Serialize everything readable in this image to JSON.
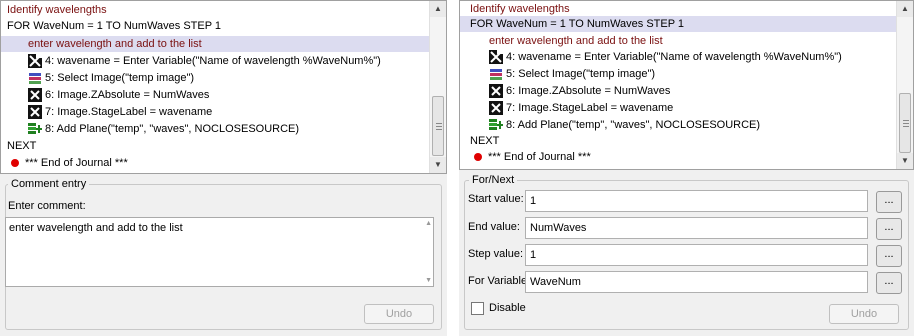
{
  "journal_lines": {
    "header": "Identify wavelengths",
    "for_line": "FOR WaveNum = 1 TO NumWaves STEP 1",
    "comment": "enter wavelength and add to the list",
    "step4": "4: wavename = Enter Variable(\"Name of wavelength %WaveNum%\")",
    "step5": "5: Select Image(\"temp image\")",
    "step6": "6: Image.ZAbsolute = NumWaves",
    "step7": "7: Image.StageLabel = wavename",
    "step8": "8: Add Plane(\"temp\", \"waves\", NOCLOSESOURCE)",
    "next": "NEXT",
    "end": "*** End of Journal ***"
  },
  "icons": {
    "step4": "enter-variable-icon",
    "step5": "select-image-icon",
    "step6": "variable-assign-icon",
    "step7": "variable-assign-icon",
    "step8": "add-plane-icon",
    "end": "end-marker-dot"
  },
  "left": {
    "group_title": "Comment entry",
    "enter_comment_label": "Enter comment:",
    "comment_value": "enter wavelength and add to the list",
    "undo_label": "Undo"
  },
  "right": {
    "group_title": "For/Next",
    "start_label": "Start value:",
    "start_value": "1",
    "end_label": "End value:",
    "end_value": "NumWaves",
    "step_label": "Step value:",
    "step_value": "1",
    "var_label": "For Variable:",
    "var_value": "WaveNum",
    "browse_label": "...",
    "disable_label": "Disable",
    "undo_label": "Undo"
  },
  "colors": {
    "selection": "#dcdcf0",
    "comment_text": "#7a1010",
    "end_dot": "#e00000"
  }
}
